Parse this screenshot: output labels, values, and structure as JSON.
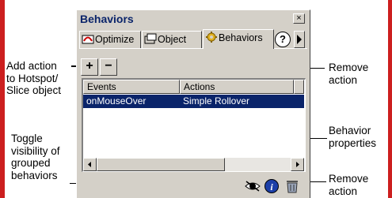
{
  "panel": {
    "title": "Behaviors",
    "close_label": "×",
    "tabs": [
      {
        "label": "Optimize"
      },
      {
        "label": "Object"
      },
      {
        "label": "Behaviors"
      }
    ],
    "help_label": "?",
    "toolbar": {
      "add_label": "+",
      "remove_label": "−"
    },
    "list": {
      "columns": [
        "Events",
        "Actions"
      ],
      "rows": [
        {
          "event": "onMouseOver",
          "action": "Simple Rollover",
          "selected": true
        }
      ]
    }
  },
  "callouts": {
    "add_action": "Add action\nto Hotspot/\nSlice object",
    "remove_action_top": "Remove\naction",
    "toggle_visibility": "Toggle\nvisibility of\ngrouped\nbehaviors",
    "behavior_properties": "Behavior\nproperties",
    "remove_action_bottom": "Remove\naction"
  },
  "colors": {
    "frame": "#cc1f1f",
    "panel": "#d4d0c8",
    "selection": "#0a246a",
    "title": "#0a246a"
  },
  "icons": [
    "optimize-icon",
    "object-icon",
    "behaviors-icon",
    "help-icon",
    "eye-icon",
    "info-icon",
    "trash-icon"
  ]
}
